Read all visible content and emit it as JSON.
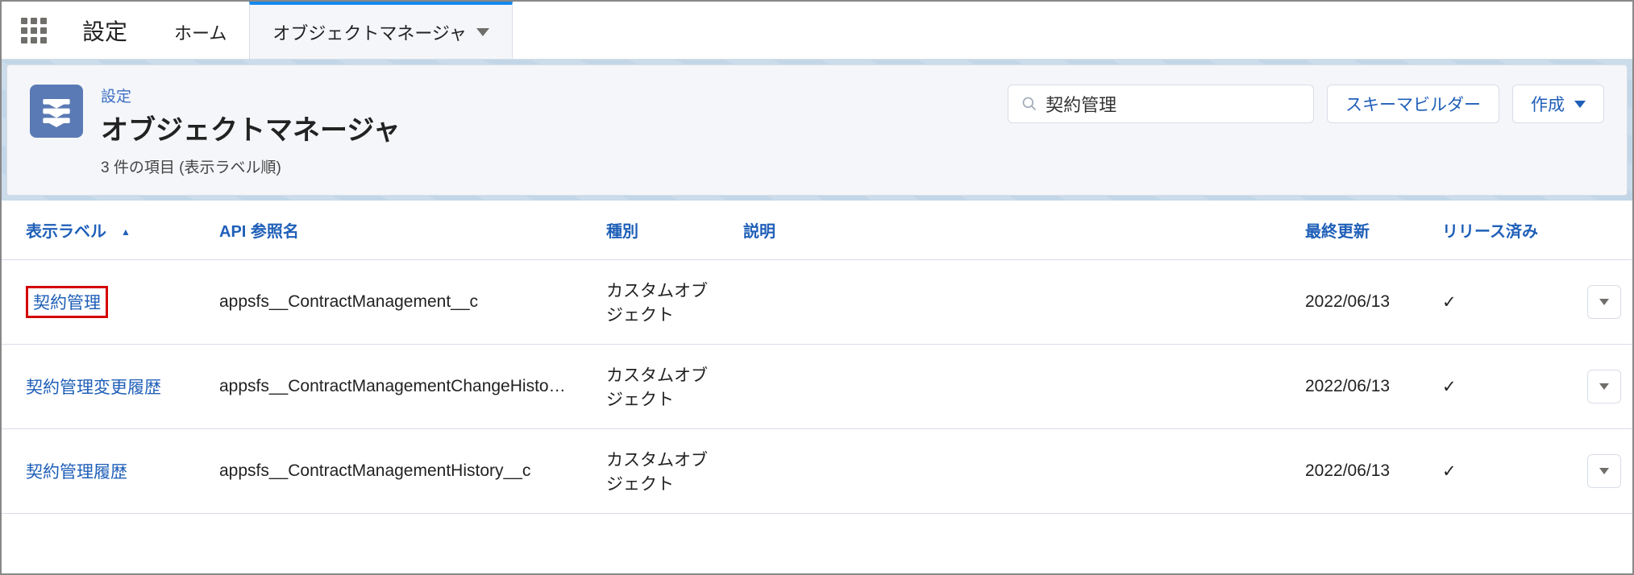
{
  "nav": {
    "app_title": "設定",
    "tabs": [
      {
        "label": "ホーム",
        "active": false
      },
      {
        "label": "オブジェクトマネージャ",
        "active": true,
        "dropdown": true
      }
    ]
  },
  "header": {
    "eyebrow": "設定",
    "title": "オブジェクトマネージャ",
    "subtitle": "3 件の項目 (表示ラベル順)",
    "search_value": "契約管理",
    "schema_builder_label": "スキーマビルダー",
    "create_label": "作成"
  },
  "columns": {
    "label": "表示ラベル",
    "api_name": "API 参照名",
    "type": "種別",
    "description": "説明",
    "last_modified": "最終更新",
    "released": "リリース済み"
  },
  "rows": [
    {
      "label": "契約管理",
      "api_name": "appsfs__ContractManagement__c",
      "type": "カスタムオブジェクト",
      "description": "",
      "last_modified": "2022/06/13",
      "released": true,
      "highlighted": true
    },
    {
      "label": "契約管理変更履歴",
      "api_name": "appsfs__ContractManagementChangeHistory__c",
      "type": "カスタムオブジェクト",
      "description": "",
      "last_modified": "2022/06/13",
      "released": true,
      "highlighted": false
    },
    {
      "label": "契約管理履歴",
      "api_name": "appsfs__ContractManagementHistory__c",
      "type": "カスタムオブジェクト",
      "description": "",
      "last_modified": "2022/06/13",
      "released": true,
      "highlighted": false
    }
  ]
}
